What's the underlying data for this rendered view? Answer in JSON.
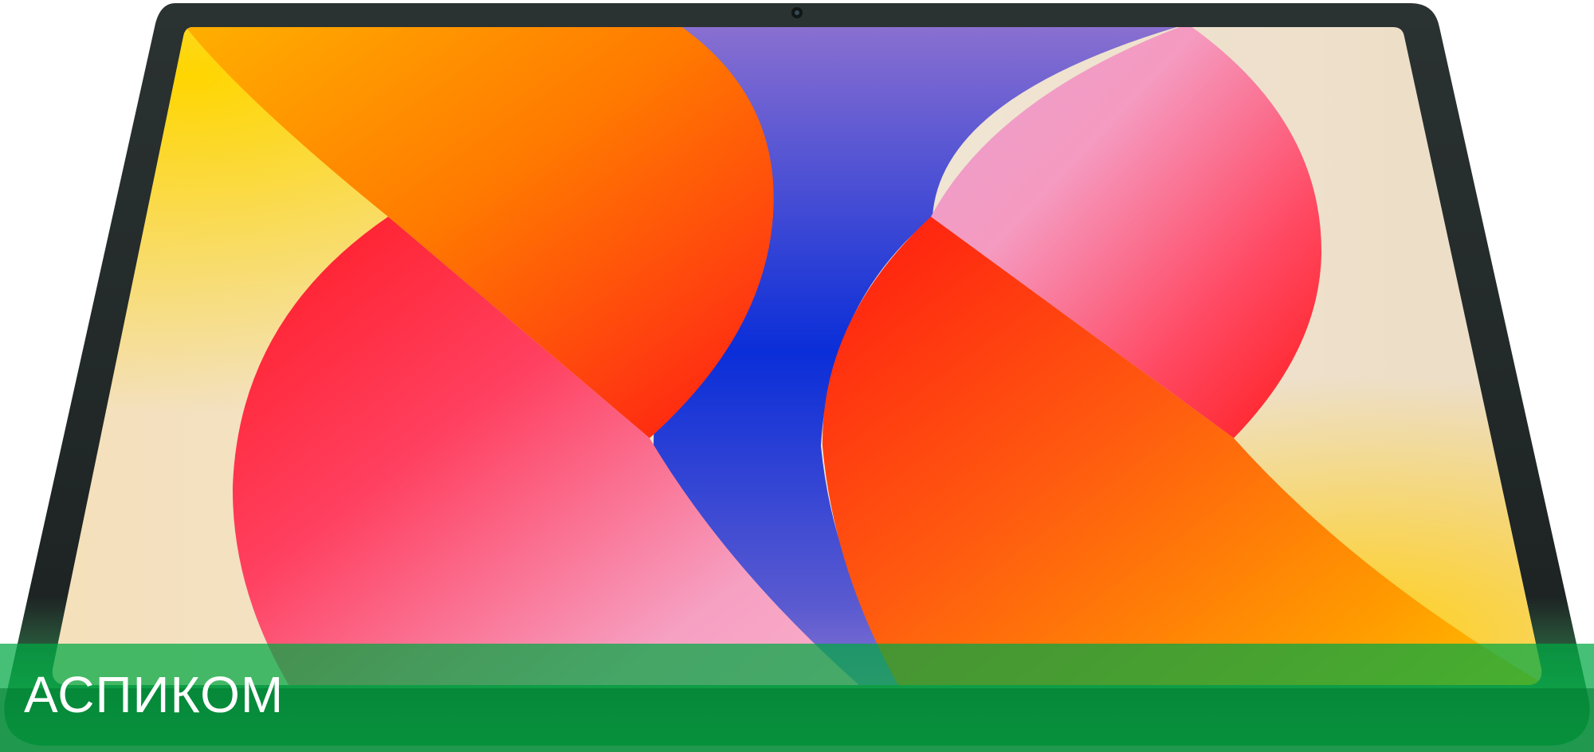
{
  "brand": {
    "label": "АСПИКОМ",
    "overlay_color": "#00a842",
    "text_color": "#ffffff"
  },
  "device": {
    "frame_color": "#2a3030",
    "shell_color": "#3fc06a",
    "camera_icon": "camera-icon"
  },
  "wallpaper": {
    "colors": [
      "#ffd600",
      "#ff8c00",
      "#ff1a1a",
      "#ff4d6d",
      "#f7a1c4",
      "#7a6cd4",
      "#0b2fd8",
      "#f3e6cf"
    ]
  }
}
